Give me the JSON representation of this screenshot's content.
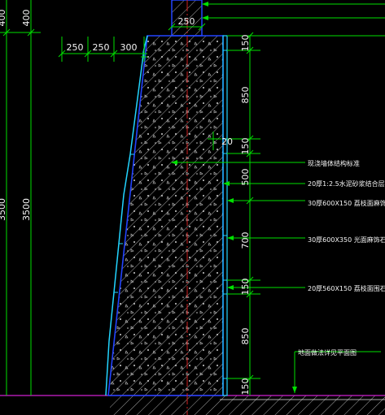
{
  "dimensions": {
    "left_top_a": "400",
    "left_top_b": "400",
    "left_total_a": "3500",
    "left_total_b": "3500",
    "top_center": "250",
    "widths": [
      "250",
      "250",
      "300"
    ],
    "right_stack": [
      "150",
      "850",
      "150",
      "500",
      "700",
      "150",
      "850",
      "150"
    ],
    "inner_20": "20"
  },
  "annotations": [
    "现浇墙体结构标准",
    "20厚1:2.5水泥砂浆结合层",
    "30厚600X150 荔枝面麻饰石",
    "30厚600X350 光面麻饰石",
    "20厚560X150 荔枝面围石",
    "地面做法详见平面图"
  ],
  "colors": {
    "background": "#000000",
    "dimension_line": "#00e000",
    "wall_outline": "#2244ff",
    "stone_cladding": "#22d4ff",
    "hatch": "#e8e8e8",
    "axis": "#d02020",
    "ground": "#d020d0",
    "text": "#f4f4f4"
  }
}
